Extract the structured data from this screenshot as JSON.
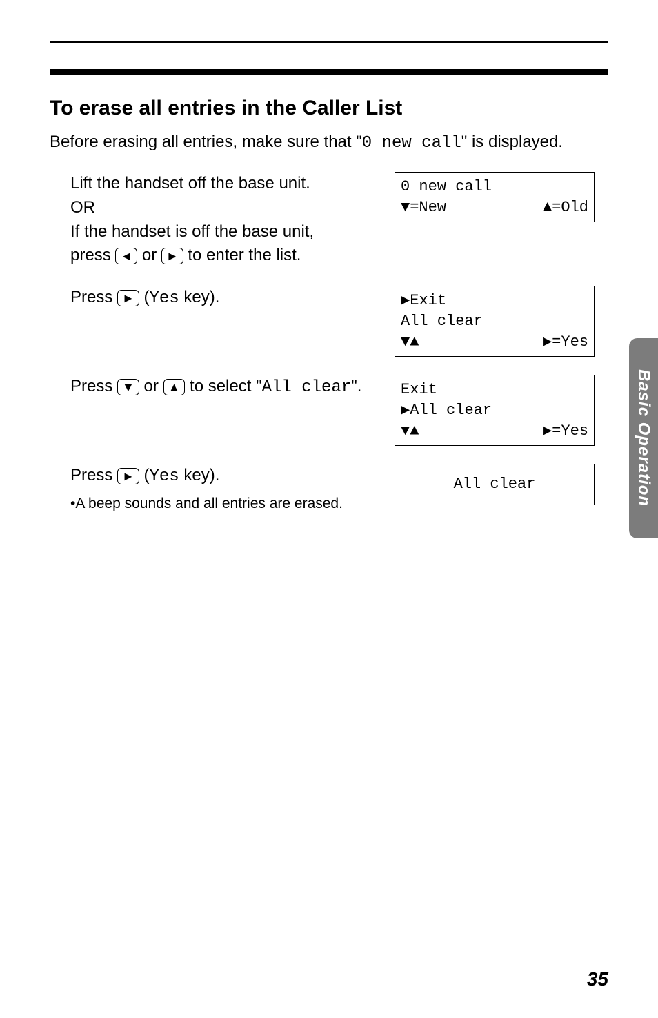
{
  "heading": "To erase all entries in the Caller List",
  "intro_prefix": "Before erasing all entries, make sure that \"",
  "intro_code": "0 new call",
  "intro_suffix": "\" is displayed.",
  "steps": {
    "s1": {
      "line1": "Lift the handset off the base unit.",
      "line2": "OR",
      "line3": "If the handset is off the base unit,",
      "line4_a": "press ",
      "line4_b": " or ",
      "line4_c": " to enter the list."
    },
    "s2": {
      "a": "Press ",
      "b": " (",
      "code": "Yes",
      "c": " key)."
    },
    "s3": {
      "a": "Press ",
      "b": " or ",
      "c": " to select \"",
      "code": "All clear",
      "d": "\"."
    },
    "s4": {
      "a": "Press ",
      "b": " (",
      "code": "Yes",
      "c": " key).",
      "bullet": "•A beep sounds and all entries are erased."
    }
  },
  "lcd": {
    "d1": {
      "line1": "  0 new call",
      "left": "▼=New",
      "right": "▲=Old"
    },
    "d2": {
      "line1": "▶Exit",
      "line2": " All clear",
      "left": "▼▲",
      "right": "▶=Yes"
    },
    "d3": {
      "line1": " Exit",
      "line2": "▶All clear",
      "left": "▼▲",
      "right": "▶=Yes"
    },
    "d4": {
      "line1": "All clear"
    }
  },
  "keys": {
    "left": "◄",
    "right": "►",
    "up": "▲",
    "down": "▼"
  },
  "tab_label": "Basic Operation",
  "page_number": "35"
}
